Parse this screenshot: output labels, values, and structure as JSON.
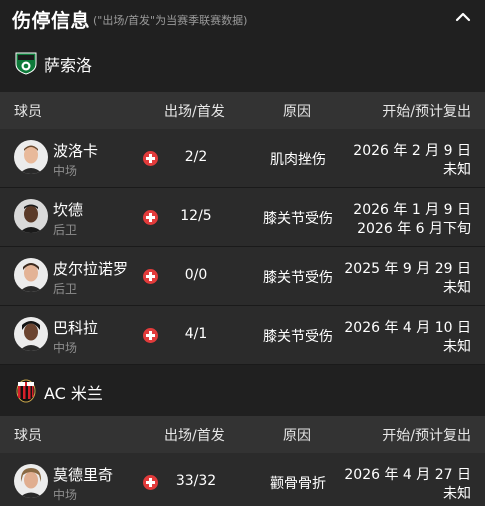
{
  "header": {
    "title": "伤停信息",
    "subtitle": "(\"出场/首发\"为当赛季联赛数据)"
  },
  "columns": {
    "player": "球员",
    "apps": "出场/首发",
    "reason": "原因",
    "dates": "开始/预计复出"
  },
  "teams": [
    {
      "name": "萨索洛",
      "players": [
        {
          "name": "波洛卡",
          "position": "中场",
          "apps": "2/2",
          "reason": "肌肉挫伤",
          "start": "2026 年 2 月 9 日",
          "return": "未知"
        },
        {
          "name": "坎德",
          "position": "后卫",
          "apps": "12/5",
          "reason": "膝关节受伤",
          "start": "2026 年 1 月 9 日",
          "return": "2026 年 6 月下旬"
        },
        {
          "name": "皮尔拉诺罗",
          "position": "后卫",
          "apps": "0/0",
          "reason": "膝关节受伤",
          "start": "2025 年 9 月 29 日",
          "return": "未知"
        },
        {
          "name": "巴科拉",
          "position": "中场",
          "apps": "4/1",
          "reason": "膝关节受伤",
          "start": "2026 年 4 月 10 日",
          "return": "未知"
        }
      ]
    },
    {
      "name": "AC 米兰",
      "players": [
        {
          "name": "莫德里奇",
          "position": "中场",
          "apps": "33/32",
          "reason": "颧骨骨折",
          "start": "2026 年 4 月 27 日",
          "return": "未知"
        }
      ]
    }
  ],
  "colors": {
    "background": "#202020",
    "header_row": "#333333",
    "player_row": "#2b2b2b",
    "injury_badge": "#e23b3b",
    "muted_text": "#8e8e8e"
  }
}
